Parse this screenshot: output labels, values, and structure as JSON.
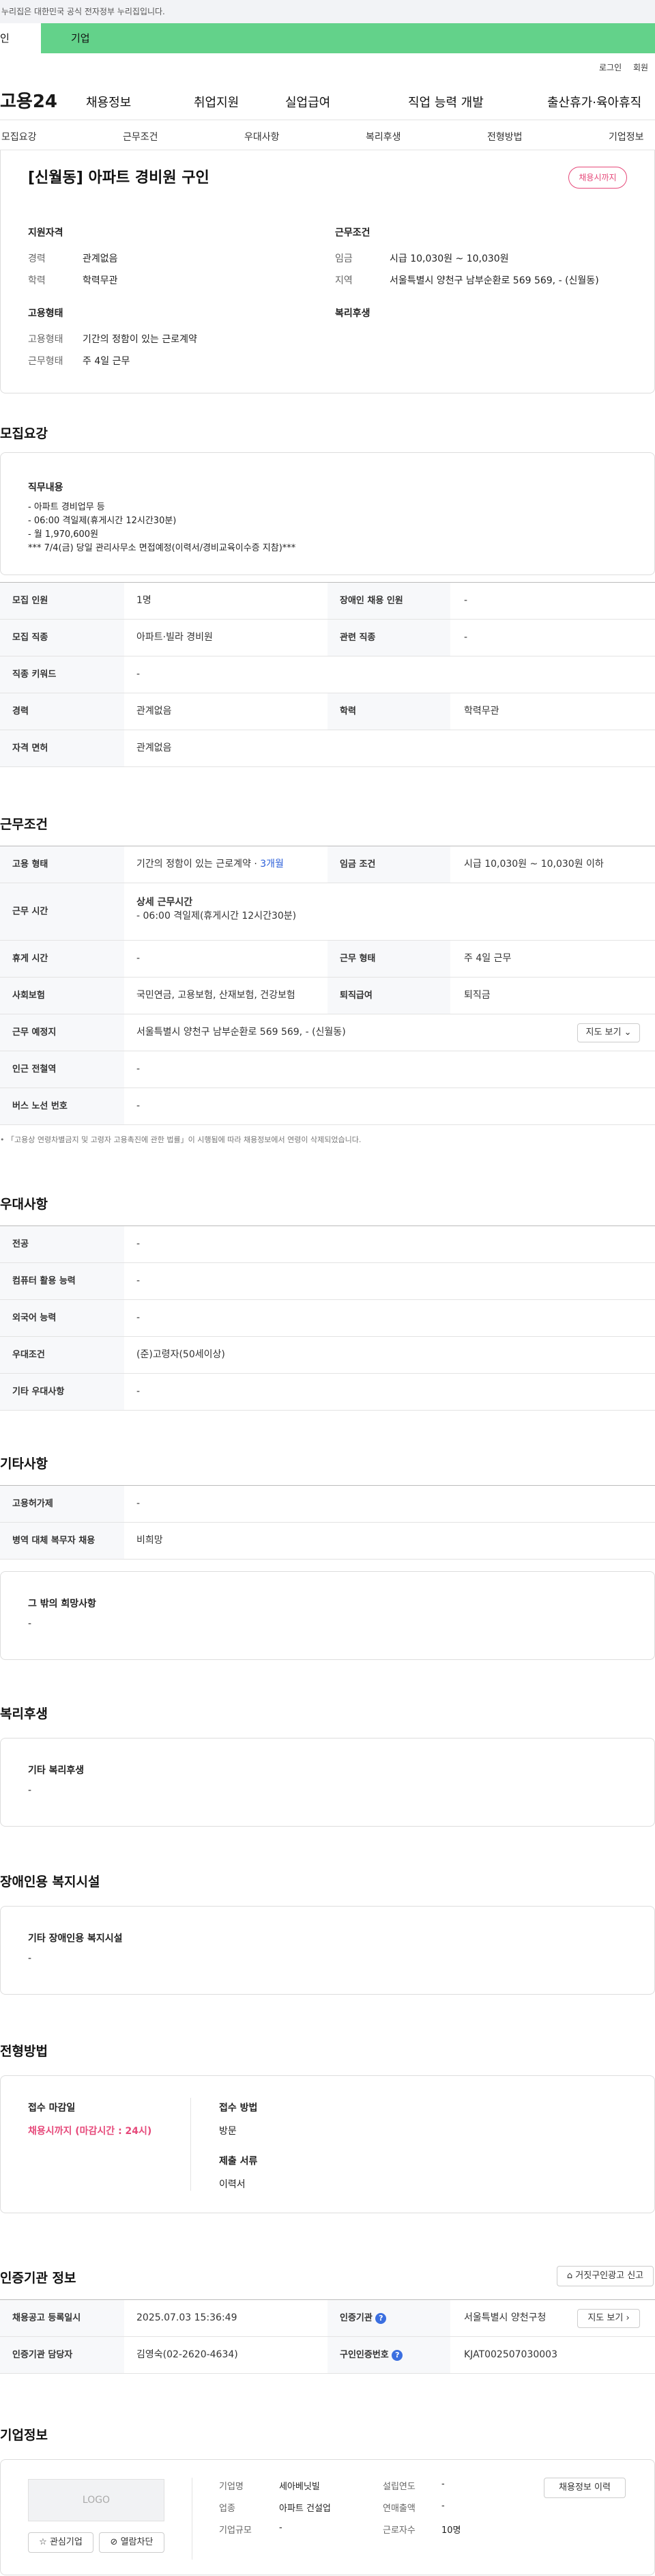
{
  "notice": "누리집은 대한민국 공식 전자정부 누리집입니다.",
  "topTabs": [
    "인",
    "기업"
  ],
  "util": {
    "login": "로그인",
    "join": "회원"
  },
  "logo": "고용24",
  "gnb": [
    "채용정보",
    "취업지원",
    "실업급여",
    "직업 능력 개발",
    "출산휴가·육아휴직"
  ],
  "subnav": [
    "모집요강",
    "근무조건",
    "우대사항",
    "복리후생",
    "전형방법",
    "기업정보"
  ],
  "summary": {
    "title": "[신월동] 아파트 경비원 구인",
    "deadline_pill": "채용시까지",
    "qual_heading": "지원자격",
    "career_label": "경력",
    "career_value": "관계없음",
    "edu_label": "학력",
    "edu_value": "학력무관",
    "emp_heading": "고용형태",
    "emptype_label": "고용형태",
    "emptype_value": "기간의 정함이 있는 근로계약",
    "workform_label": "근무형태",
    "workform_value": "주 4일 근무",
    "cond_heading": "근무조건",
    "wage_label": "임금",
    "wage_value": "시급 10,030원 ~ 10,030원",
    "region_label": "지역",
    "region_value": "서울특별시 양천구 남부순환로 569 569, - (신월동)",
    "welfare_heading": "복리후생"
  },
  "recruit": {
    "title": "모집요강",
    "duty_heading": "직무내용",
    "duty_lines": [
      "- 아파트 경비업무 등",
      "- 06:00 격일제(휴게시간 12시간30분)",
      "- 월 1,970,600원",
      "*** 7/4(금) 당일 관리사무소 면접예정(이력서/경비교육이수증 지참)***"
    ],
    "rows": [
      {
        "k": "모집 인원",
        "v": "1명",
        "k2": "장애인 채용 인원",
        "v2": "-"
      },
      {
        "k": "모집 직종",
        "v": "아파트·빌라 경비원",
        "k2": "관련 직종",
        "v2": "-"
      },
      {
        "k": "직종 키워드",
        "v": "-"
      },
      {
        "k": "경력",
        "v": "관계없음",
        "k2": "학력",
        "v2": "학력무관"
      },
      {
        "k": "자격 면허",
        "v": "관계없음"
      }
    ]
  },
  "conditions": {
    "title": "근무조건",
    "row1": {
      "k": "고용 형태",
      "v": "기간의 정함이 있는 근로계약 · ",
      "v_link": "3개월",
      "k2": "임금 조건",
      "v2": "시급 10,030원 ~ 10,030원 이하"
    },
    "row2": {
      "k": "근무 시간",
      "v_head": "상세 근무시간",
      "v_line": "- 06:00 격일제(휴게시간 12시간30분)"
    },
    "row3": {
      "k": "휴게 시간",
      "v": "-",
      "k2": "근무 형태",
      "v2": "주 4일 근무"
    },
    "row4": {
      "k": "사회보험",
      "v": "국민연금, 고용보험, 산재보험, 건강보험",
      "k2": "퇴직급여",
      "v2": "퇴직금"
    },
    "row5": {
      "k": "근무 예정지",
      "v": "서울특별시 양천구 남부순환로 569 569, - (신월동)",
      "btn": "지도 보기"
    },
    "row6": {
      "k": "인근 전철역",
      "v": "-"
    },
    "row7": {
      "k": "버스 노선 번호",
      "v": "-"
    },
    "footnote": "「고용상 연령차별금지 및 고령자 고용촉진에 관한 법률」이 시행됨에 따라 채용정보에서 연령이 삭제되었습니다."
  },
  "prefer": {
    "title": "우대사항",
    "rows": [
      {
        "k": "전공",
        "v": "-"
      },
      {
        "k": "컴퓨터 활용 능력",
        "v": "-"
      },
      {
        "k": "외국어 능력",
        "v": "-"
      },
      {
        "k": "우대조건",
        "v": "(준)고령자(50세이상)"
      },
      {
        "k": "기타 우대사항",
        "v": "-"
      }
    ]
  },
  "etc": {
    "title": "기타사항",
    "rows": [
      {
        "k": "고용허가제",
        "v": "-"
      },
      {
        "k": "병역 대체 복무자 채용",
        "v": "비희망"
      }
    ],
    "box_heading": "그 밖의 희망사항",
    "box_value": "-"
  },
  "welfare": {
    "title": "복리후생",
    "heading": "기타 복리후생",
    "value": "-"
  },
  "disability": {
    "title": "장애인용 복지시설",
    "heading": "기타 장애인용 복지시설",
    "value": "-"
  },
  "selection": {
    "title": "전형방법",
    "deadline_heading": "접수 마감일",
    "deadline_value": "채용시까지 (마감시간 : 24시)",
    "method_heading": "접수 방법",
    "method_value": "방문",
    "docs_heading": "제출 서류",
    "docs_value": "이력서"
  },
  "cert": {
    "title": "인증기관 정보",
    "report_btn": "거짓구인광고 신고",
    "row1": {
      "k": "채용공고 등록일시",
      "v": "2025.07.03 15:36:49",
      "k2": "인증기관",
      "v2": "서울특별시 양천구청",
      "btn": "지도 보기"
    },
    "row2": {
      "k": "인증기관 담당자",
      "v": "김영숙(02-2620-4634)",
      "k2": "구인인증번호",
      "v2": "KJAT002507030003"
    }
  },
  "company": {
    "title": "기업정보",
    "logo_text": "LOGO",
    "btn_fav": "관심기업",
    "btn_close": "열람차단",
    "btn_jobs": "채용정보 이력",
    "name_label": "기업명",
    "name_value": "세아베닛빌",
    "industry_label": "업종",
    "industry_value": "아파트 건설업",
    "size_label": "기업규모",
    "size_value": "-",
    "founded_label": "설립연도",
    "founded_value": "-",
    "sales_label": "연매출액",
    "sales_value": "-",
    "employees_label": "근로자수",
    "employees_value": "10명"
  }
}
